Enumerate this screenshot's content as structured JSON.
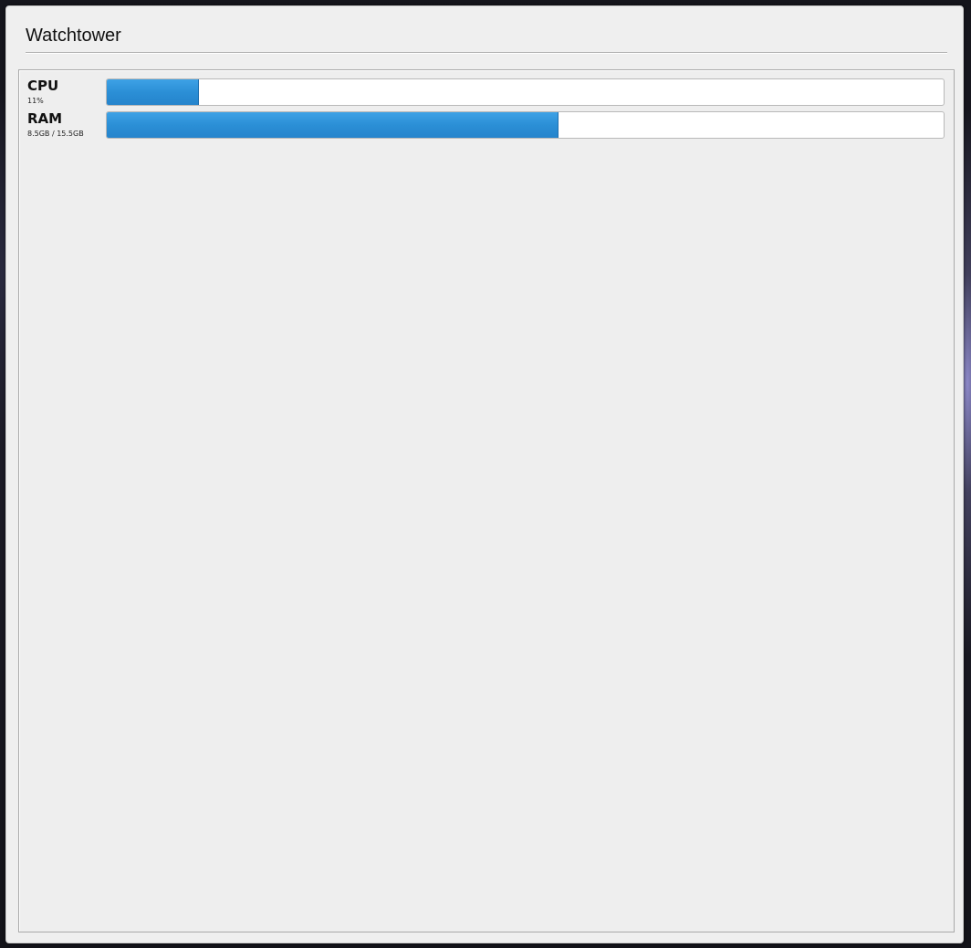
{
  "window": {
    "title": "Watchtower"
  },
  "metrics": {
    "cpu": {
      "label": "CPU",
      "detail": "11%",
      "fraction": 0.11
    },
    "ram": {
      "label": "RAM",
      "detail": "8.5GB / 15.5GB",
      "fraction": 0.54
    }
  },
  "colors": {
    "bar_fill": "#2b8fd6",
    "window_bg": "#efefef"
  }
}
